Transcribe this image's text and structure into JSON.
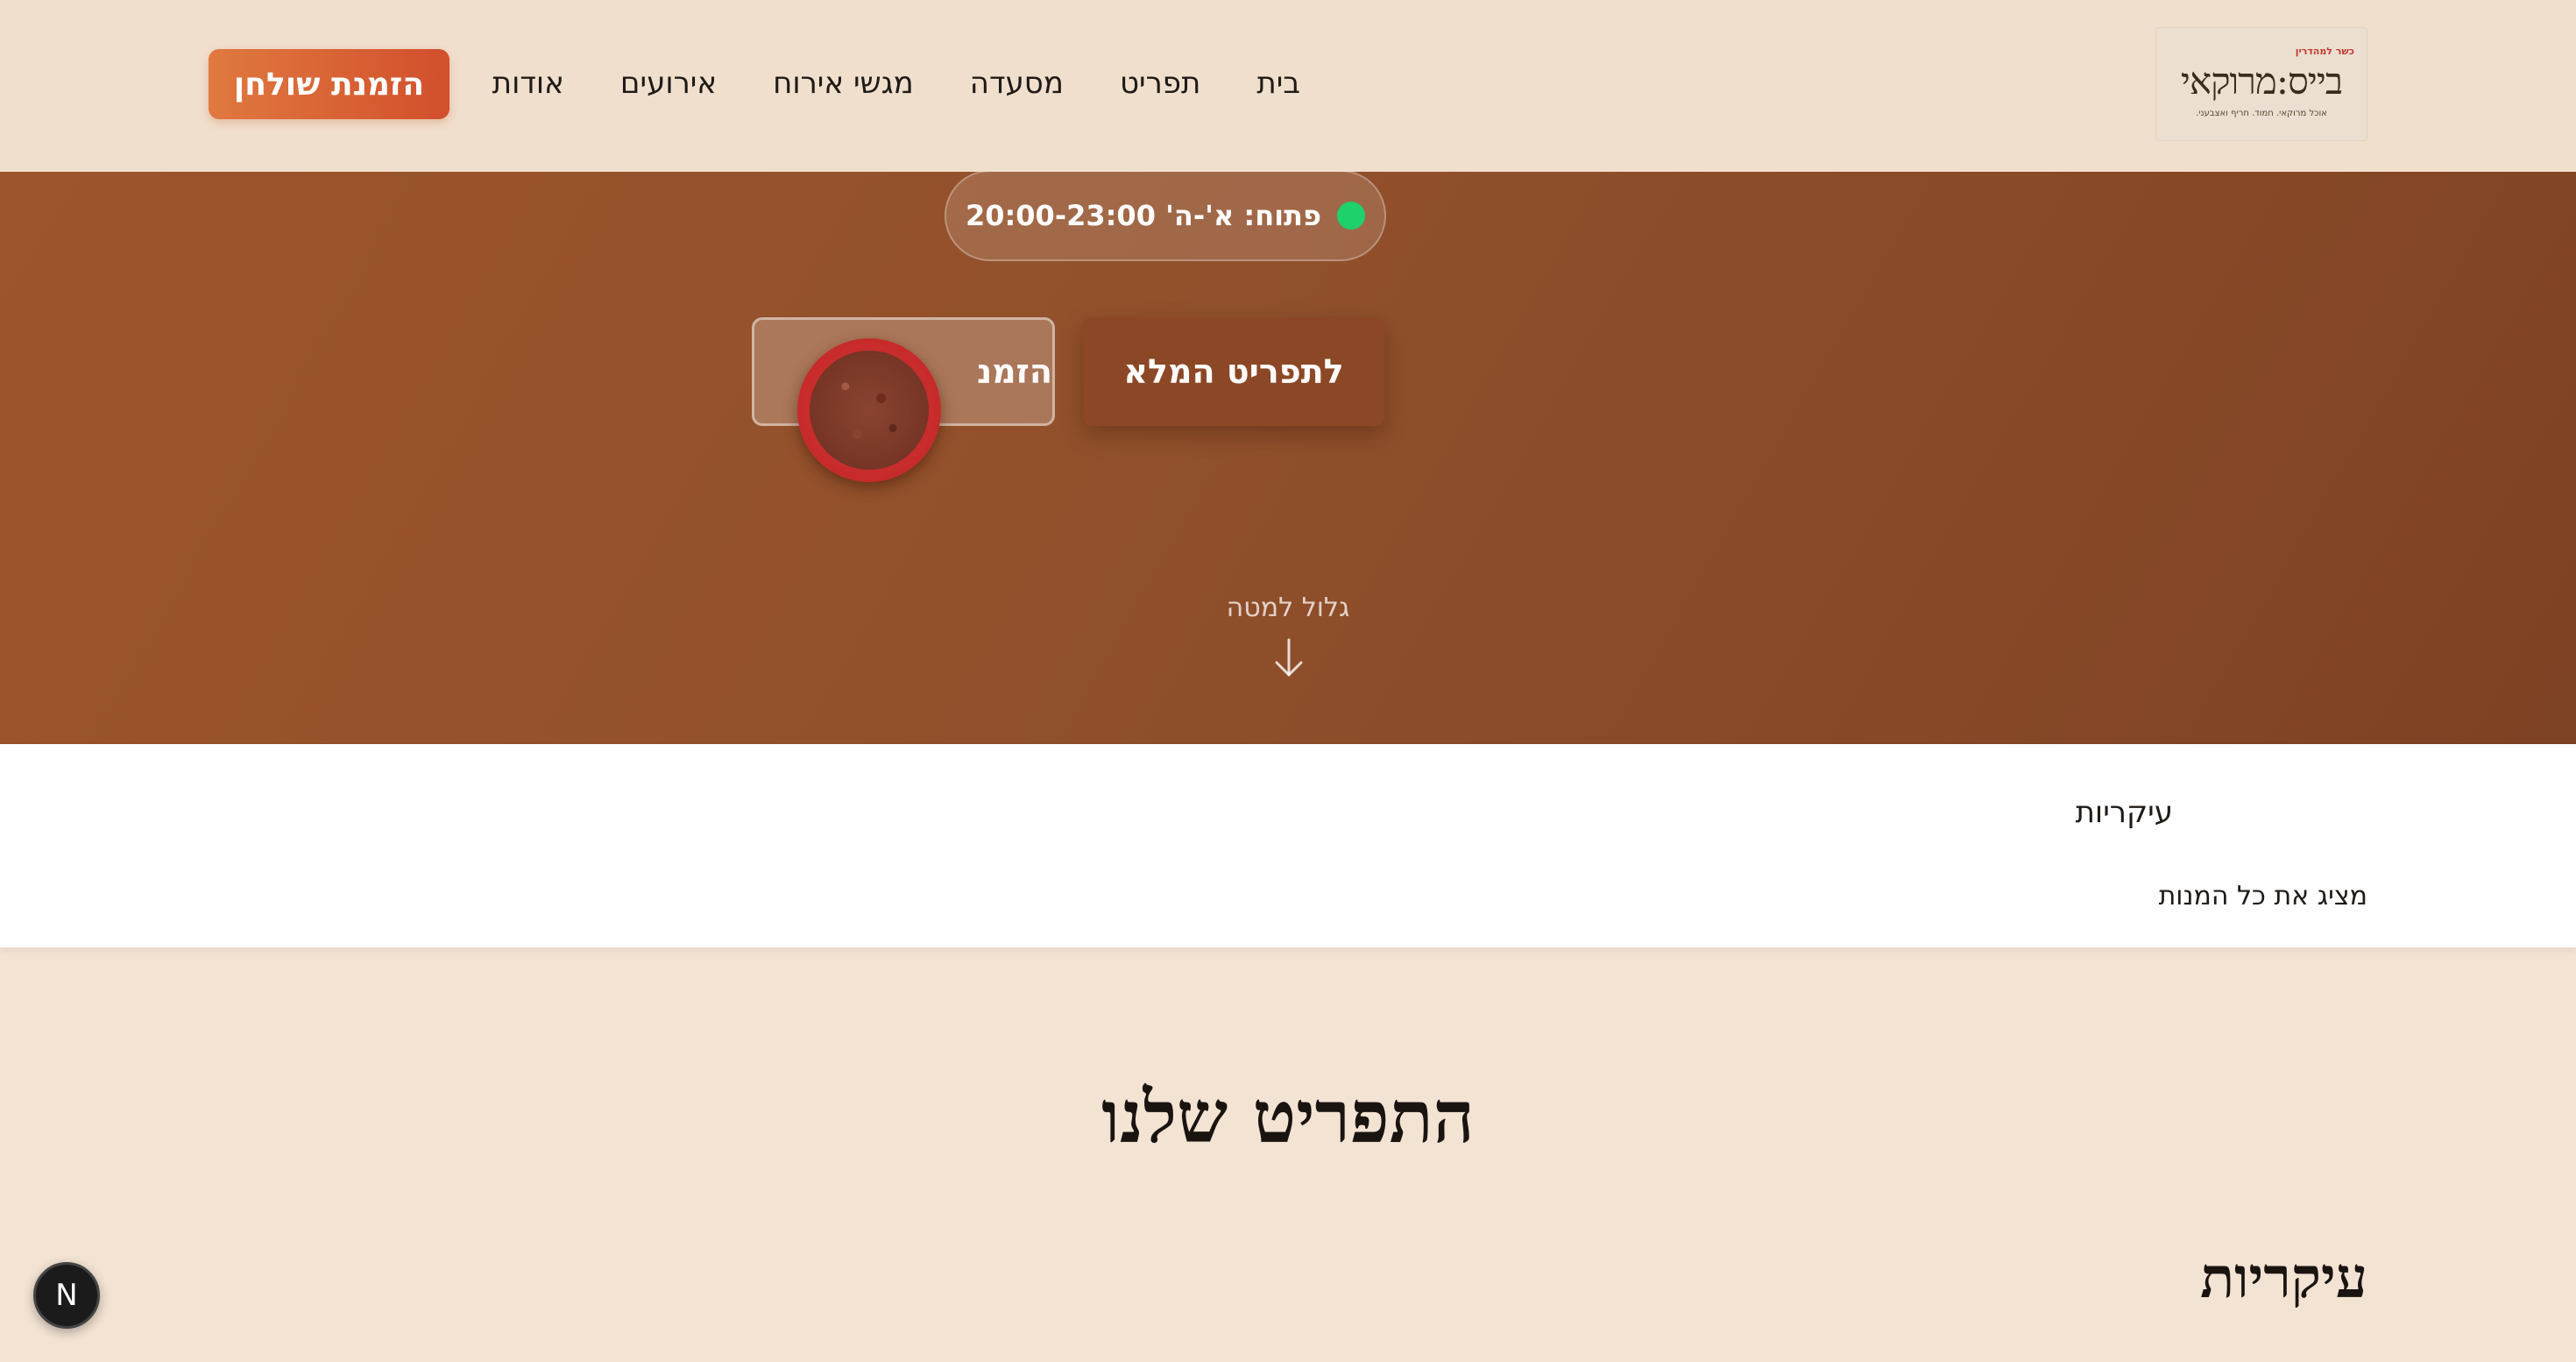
{
  "header": {
    "logo": {
      "kosher_label": "כשר למהדרין",
      "wordmark": "בייס:מרוקאי",
      "tagline": "אוכל מרוקאי. חמוד. חריף ואצבעני."
    },
    "nav": [
      {
        "label": "בית"
      },
      {
        "label": "תפריט"
      },
      {
        "label": "מסעדה"
      },
      {
        "label": "מגשי אירוח"
      },
      {
        "label": "אירועים"
      },
      {
        "label": "אודות"
      }
    ],
    "reserve_button": "הזמנת שולחן"
  },
  "hero": {
    "hours": "פתוח: א'-ה' 20:00-23:00",
    "status_color": "#1ed16a",
    "full_menu_button": "לתפריט המלא",
    "reserve_button_partial": "הזמנ",
    "scroll_hint": "גלול למטה"
  },
  "categories": {
    "active_tab": "עיקריות",
    "show_all": "מציג את כל המנות"
  },
  "menu": {
    "title": "התפריט שלנו",
    "category_heading": "עיקריות"
  },
  "dev_badge": "N",
  "colors": {
    "accent": "#d24f2c",
    "hero": "#91502b",
    "cream": "#f3e3d3"
  }
}
